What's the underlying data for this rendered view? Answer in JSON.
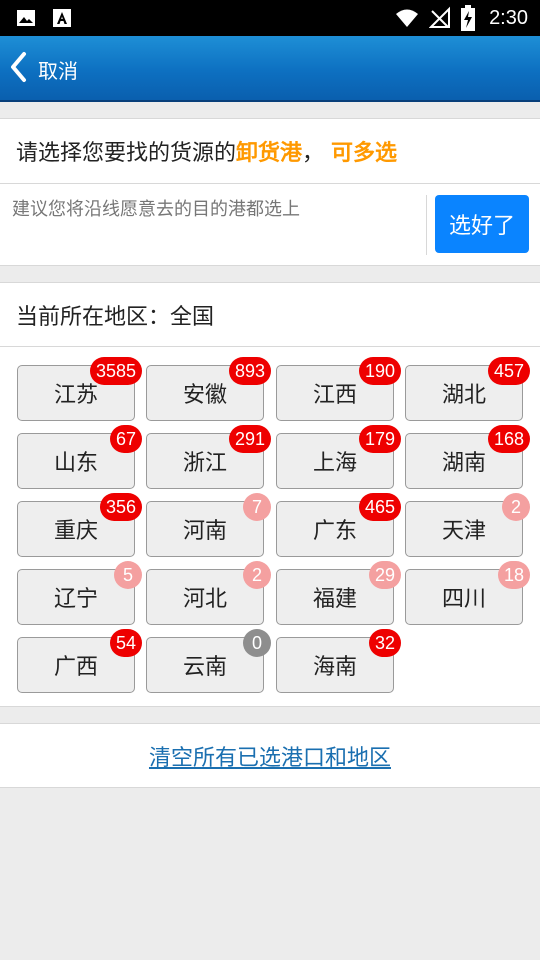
{
  "status_bar": {
    "time": "2:30",
    "left_icons": [
      "image-icon",
      "a-icon"
    ],
    "right_icons": [
      "wifi-icon",
      "no-signal-icon",
      "battery-charging-icon"
    ]
  },
  "app_bar": {
    "back_label": "取消",
    "colors": {
      "gradient_top": "#1e8fd6",
      "gradient_bottom": "#0a5fae"
    }
  },
  "instruction": {
    "prefix": "请选择您要找的货源的",
    "highlight1": "卸货港",
    "separator": "，",
    "highlight2": "可多选",
    "highlight_color": "#ff9900"
  },
  "hint": {
    "text": "建议您将沿线愿意去的目的港都选上",
    "done_button": "选好了",
    "done_color": "#0a84ff"
  },
  "location": {
    "label": "当前所在地区：全国"
  },
  "regions": [
    {
      "name": "江苏",
      "count": "3585",
      "badge_style": "red"
    },
    {
      "name": "安徽",
      "count": "893",
      "badge_style": "red"
    },
    {
      "name": "江西",
      "count": "190",
      "badge_style": "red"
    },
    {
      "name": "湖北",
      "count": "457",
      "badge_style": "red"
    },
    {
      "name": "山东",
      "count": "67",
      "badge_style": "red"
    },
    {
      "name": "浙江",
      "count": "291",
      "badge_style": "red"
    },
    {
      "name": "上海",
      "count": "179",
      "badge_style": "red"
    },
    {
      "name": "湖南",
      "count": "168",
      "badge_style": "red"
    },
    {
      "name": "重庆",
      "count": "356",
      "badge_style": "red"
    },
    {
      "name": "河南",
      "count": "7",
      "badge_style": "pink"
    },
    {
      "name": "广东",
      "count": "465",
      "badge_style": "red"
    },
    {
      "name": "天津",
      "count": "2",
      "badge_style": "pink"
    },
    {
      "name": "辽宁",
      "count": "5",
      "badge_style": "pink"
    },
    {
      "name": "河北",
      "count": "2",
      "badge_style": "pink"
    },
    {
      "name": "福建",
      "count": "29",
      "badge_style": "pink"
    },
    {
      "name": "四川",
      "count": "18",
      "badge_style": "pink"
    },
    {
      "name": "广西",
      "count": "54",
      "badge_style": "red"
    },
    {
      "name": "云南",
      "count": "0",
      "badge_style": "gray"
    },
    {
      "name": "海南",
      "count": "32",
      "badge_style": "red"
    }
  ],
  "footer": {
    "clear_link": "清空所有已选港口和地区"
  }
}
